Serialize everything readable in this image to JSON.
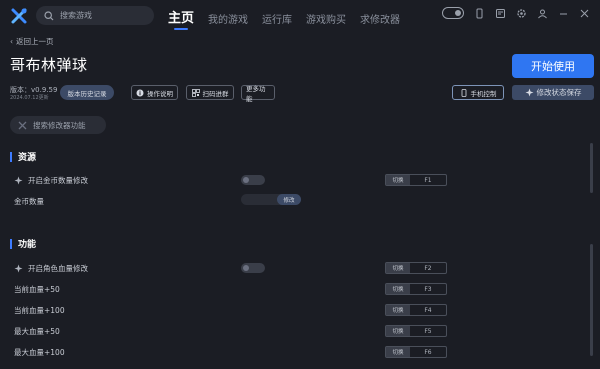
{
  "topbar": {
    "search_placeholder": "搜索游戏",
    "nav": [
      "主页",
      "我的游戏",
      "运行库",
      "游戏购买",
      "求修改器"
    ],
    "active_index": 0
  },
  "header": {
    "back_label": "返回上一页",
    "game_title": "哥布林弹球",
    "version": "版本：v0.9.59",
    "date": "2024.07.12更新",
    "history_label": "版本历史记录",
    "manual_label": "操作说明",
    "scan_label": "扫码进群",
    "more_label": "更多功能",
    "start_label": "开始使用",
    "phone_label": "手机控制",
    "save_label": "修改状态保存"
  },
  "feature_search_placeholder": "搜索修改器功能",
  "sections": [
    {
      "title": "资源",
      "rows": [
        {
          "label": "开启金币数量修改",
          "type": "switch",
          "on": false,
          "hotkey_label": "切换",
          "hotkey": "F1",
          "sparkle": true
        },
        {
          "label": "金币数量",
          "type": "slider",
          "handle_label": "修改"
        }
      ]
    },
    {
      "title": "功能",
      "rows": [
        {
          "label": "开启角色血量修改",
          "type": "switch",
          "on": false,
          "hotkey_label": "切换",
          "hotkey": "F2",
          "sparkle": true
        },
        {
          "label": "当前血量+50",
          "type": "hotkey",
          "hotkey_label": "切换",
          "hotkey": "F3"
        },
        {
          "label": "当前血量+100",
          "type": "hotkey",
          "hotkey_label": "切换",
          "hotkey": "F4"
        },
        {
          "label": "最大血量+50",
          "type": "hotkey",
          "hotkey_label": "切换",
          "hotkey": "F5"
        },
        {
          "label": "最大血量+100",
          "type": "hotkey",
          "hotkey_label": "切换",
          "hotkey": "F6"
        }
      ]
    }
  ],
  "colors": {
    "accent": "#2f76f2",
    "bg": "#1b1d24"
  }
}
